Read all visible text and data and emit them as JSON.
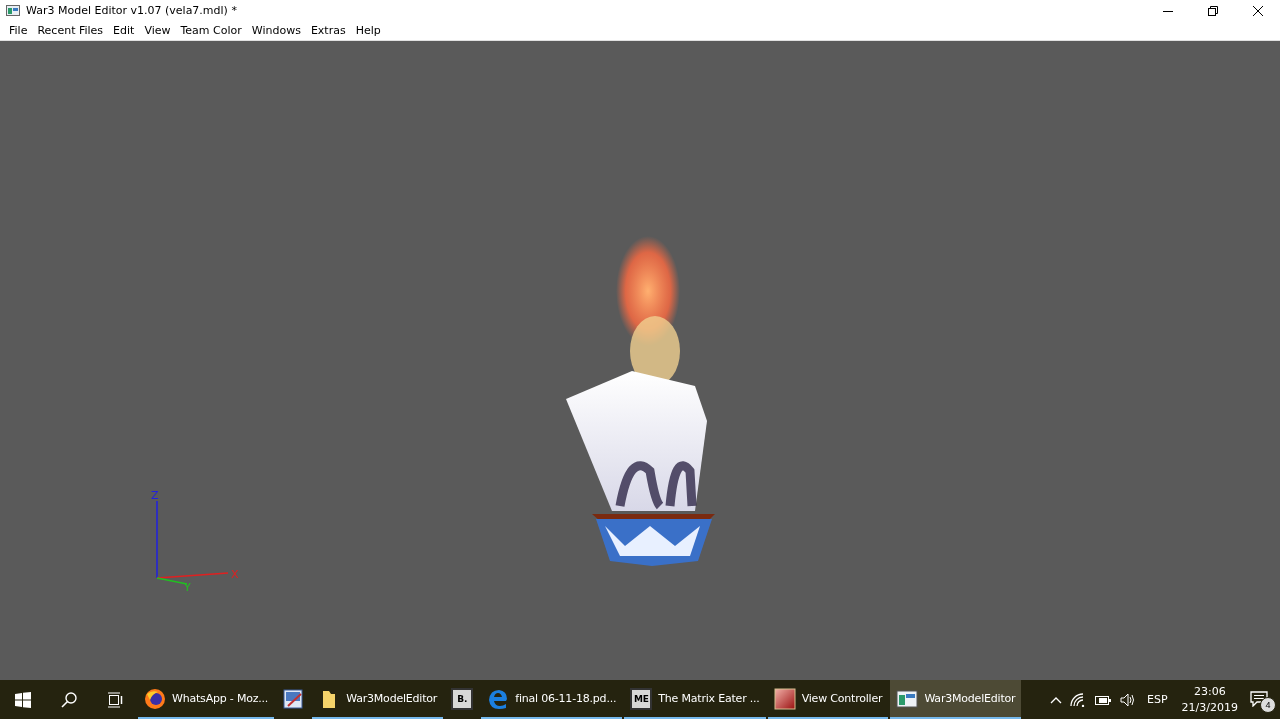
{
  "window": {
    "title": "War3 Model Editor v1.07 (vela7.mdl) *"
  },
  "menu": [
    "File",
    "Recent Files",
    "Edit",
    "View",
    "Team Color",
    "Windows",
    "Extras",
    "Help"
  ],
  "viewport": {
    "axes": {
      "x": "X",
      "y": "Y",
      "z": "Z"
    }
  },
  "taskbar": {
    "apps": [
      {
        "kind": "firefox",
        "label": "WhatsApp - Moz...",
        "running": true,
        "selected": false
      },
      {
        "kind": "paint",
        "running": false,
        "selected": false
      },
      {
        "kind": "folder",
        "label": "War3ModelEditor",
        "running": true,
        "selected": false
      },
      {
        "kind": "letter",
        "icon_text": "B.",
        "running": false,
        "selected": false
      },
      {
        "kind": "edge",
        "label": "final 06-11-18.pd...",
        "running": true,
        "selected": false
      },
      {
        "kind": "letter",
        "icon_text": "ME",
        "label": "The Matrix Eater ...",
        "running": true,
        "selected": false
      },
      {
        "kind": "gradient",
        "label": "View Controller",
        "running": true,
        "selected": false
      },
      {
        "kind": "window",
        "label": "War3ModelEditor",
        "running": true,
        "selected": true
      }
    ],
    "language": "ESP",
    "time": "23:06",
    "date": "21/3/2019",
    "notifications": "4"
  }
}
